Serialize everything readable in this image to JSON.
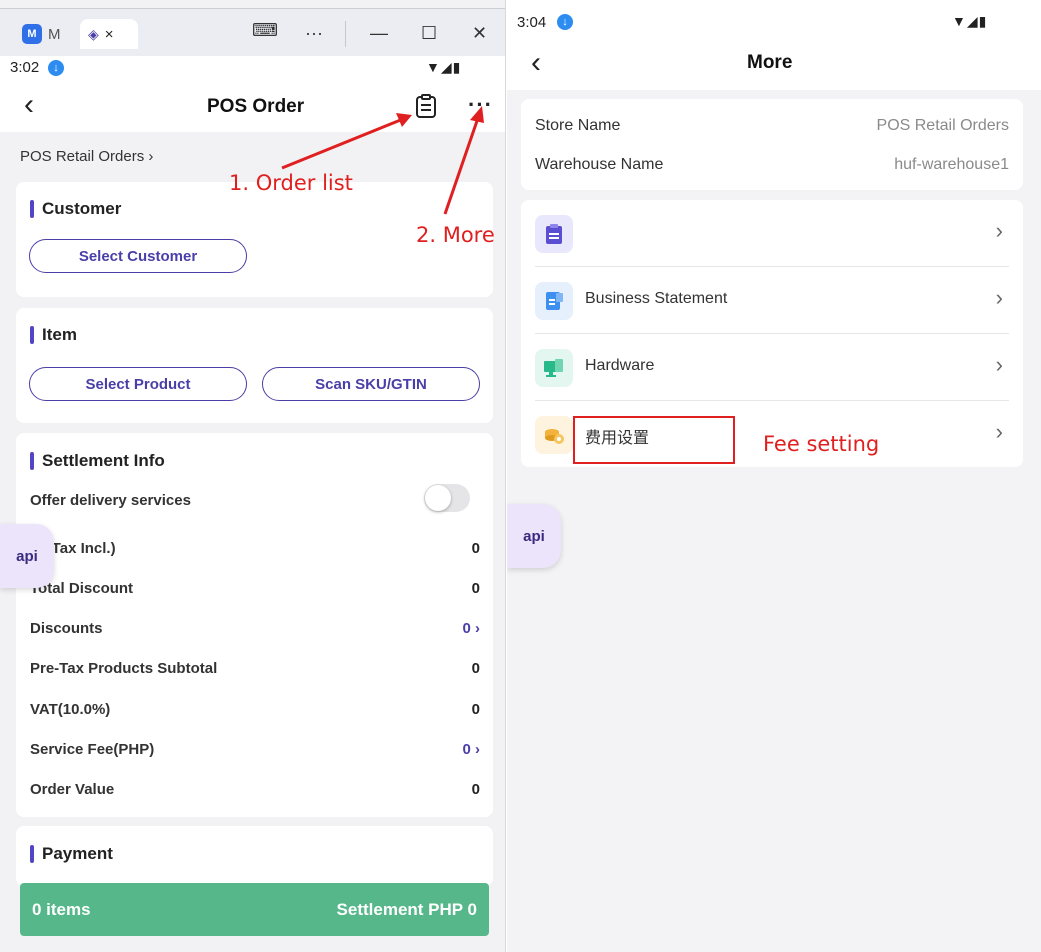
{
  "left": {
    "window_tabs": [
      {
        "icon": "M",
        "label": "M"
      },
      {
        "icon": "app-logo",
        "label": "×"
      }
    ],
    "window_controls": {
      "keyboard": "⌨",
      "more": "···",
      "minimize": "—",
      "maximize": "☐",
      "close": "✕"
    },
    "status": {
      "time": "3:02",
      "icons": "▼◢▮"
    },
    "header": {
      "back": "‹",
      "title": "POS Order"
    },
    "breadcrumb": "POS Retail Orders  ›",
    "customer": {
      "title": "Customer",
      "select_btn": "Select Customer"
    },
    "item": {
      "title": "Item",
      "select_product_btn": "Select Product",
      "scan_btn": "Scan SKU/GTIN"
    },
    "settlement": {
      "title": "Settlement Info",
      "delivery_label": "Offer delivery services",
      "delivery_enabled": false,
      "rows": [
        {
          "label": "al (Tax Incl.)",
          "value": "0",
          "link": false
        },
        {
          "label": "Total Discount",
          "value": "0",
          "link": false
        },
        {
          "label": "Discounts",
          "value": "0 ›",
          "link": true
        },
        {
          "label": "Pre-Tax Products Subtotal",
          "value": "0",
          "link": false
        },
        {
          "label": "VAT(10.0%)",
          "value": "0",
          "link": false
        },
        {
          "label": "Service Fee(PHP)",
          "value": "0 ›",
          "link": true
        },
        {
          "label": "Order Value",
          "value": "0",
          "link": false
        }
      ]
    },
    "payment": {
      "title": "Payment"
    },
    "api_fab": "api",
    "bottom_bar": {
      "items": "0 items",
      "settlement": "Settlement PHP 0"
    },
    "annotations": {
      "order_list": "1. Order list",
      "more": "2. More"
    }
  },
  "right": {
    "status": {
      "time": "3:04",
      "icons": "▼◢▮"
    },
    "header": {
      "back": "‹",
      "title": "More"
    },
    "info": [
      {
        "label": "Store Name",
        "value": "POS Retail Orders"
      },
      {
        "label": "Warehouse Name",
        "value": "huf-warehouse1"
      }
    ],
    "menu": [
      {
        "icon": "clipboard-icon",
        "label": ""
      },
      {
        "icon": "business-statement-icon",
        "label": "Business Statement"
      },
      {
        "icon": "hardware-icon",
        "label": "Hardware"
      },
      {
        "icon": "fee-setting-icon",
        "label": "费用设置"
      }
    ],
    "chevron": "›",
    "api_fab": "api",
    "annotation": "Fee setting"
  },
  "colors": {
    "accent": "#4a3fa8",
    "settle_green": "#55b78a",
    "annotation_red": "#e02020"
  }
}
